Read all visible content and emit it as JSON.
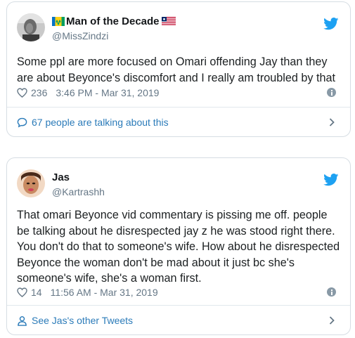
{
  "tweets": [
    {
      "display_name": "Man of the Decade",
      "handle": "@MissZindzi",
      "text": "Some ppl are more focused on Omari offending Jay than they are about Beyonce's discomfort and I really am troubled by that",
      "likes": "236",
      "timestamp": "3:46 PM - Mar 31, 2019",
      "footer_link": "67 people are talking about this",
      "flags": [
        "flag-saint-vincent-icon",
        "flag-liberia-icon"
      ]
    },
    {
      "display_name": "Jas",
      "handle": "@Kartrashh",
      "text": "That omari Beyonce vid commentary is pissing me off.  people be talking about he disrespected jay z he was stood right there. You don't do that to someone's wife. How about he disrespected Beyonce the woman don't be mad about it  just bc she's someone's wife, she's a woman first.",
      "likes": "14",
      "timestamp": "11:56 AM - Mar 31, 2019",
      "footer_link": "See Jas's other Tweets"
    }
  ],
  "colors": {
    "twitter_blue": "#1da1f2",
    "link_blue": "#2b7bb9",
    "muted_gray": "#657786",
    "border": "#d6dde3"
  }
}
